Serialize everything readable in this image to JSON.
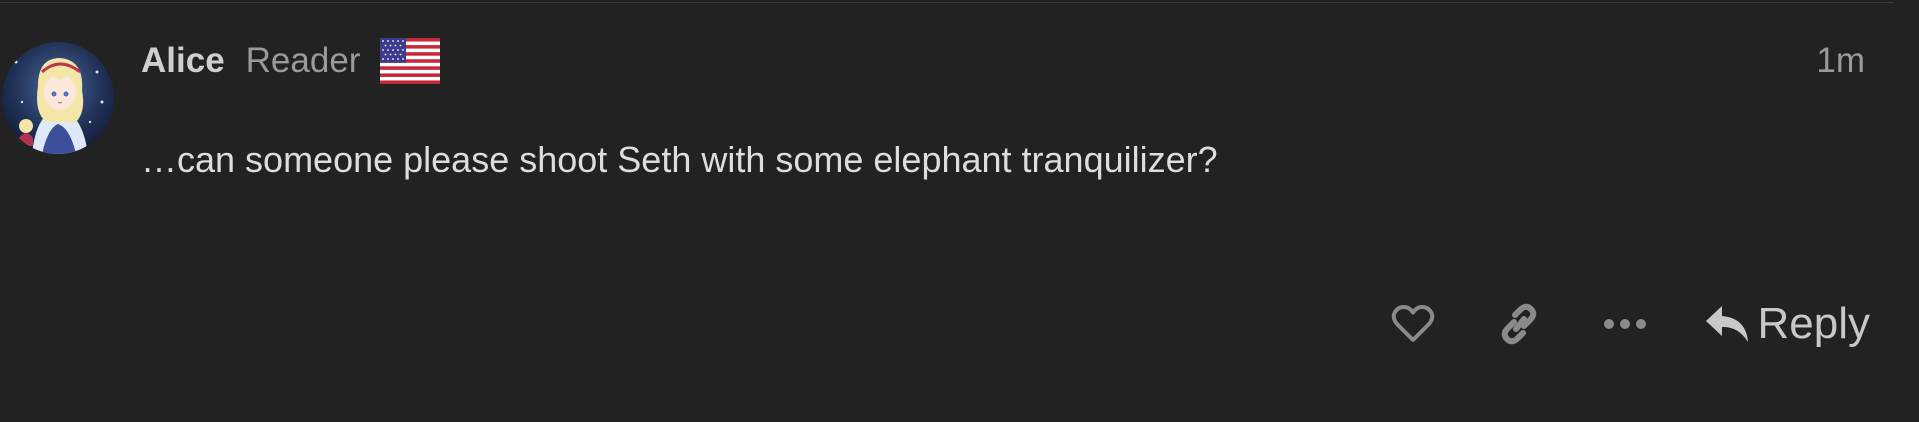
{
  "post": {
    "username": "Alice",
    "user_title": "Reader",
    "flag": "us-flag",
    "date": "1m",
    "body": "…can someone please shoot Seth with some elephant tranquilizer?"
  },
  "actions": {
    "like_icon": "heart-icon",
    "link_icon": "link-icon",
    "more_icon": "ellipsis-icon",
    "reply_icon": "reply-arrow-icon",
    "reply_label": "Reply"
  },
  "colors": {
    "background": "#222222",
    "username": "#cfcfcf",
    "muted": "#9a9a9a",
    "body_text": "#dddddd",
    "icon": "#8a8a8a"
  }
}
